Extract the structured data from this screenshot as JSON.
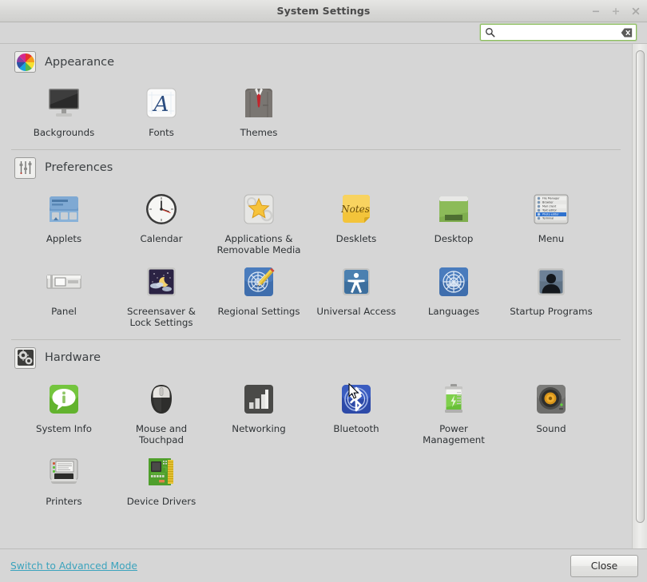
{
  "window": {
    "title": "System Settings",
    "controls": [
      {
        "name": "minimize",
        "glyph": "–"
      },
      {
        "name": "maximize",
        "glyph": "+"
      },
      {
        "name": "close",
        "glyph": "✕"
      }
    ]
  },
  "search": {
    "value": "",
    "placeholder": "",
    "icon": "search-icon",
    "clear_icon": "clear-icon",
    "border_color": "#8dbf5e"
  },
  "sections": [
    {
      "id": "appearance",
      "title": "Appearance",
      "icon": "color-wheel-icon",
      "items": [
        {
          "label": "Backgrounds",
          "icon": "monitor-icon"
        },
        {
          "label": "Fonts",
          "icon": "letter-a-icon"
        },
        {
          "label": "Themes",
          "icon": "suit-tie-icon"
        }
      ]
    },
    {
      "id": "preferences",
      "title": "Preferences",
      "icon": "sliders-icon",
      "items": [
        {
          "label": "Applets",
          "icon": "applets-panel-icon"
        },
        {
          "label": "Calendar",
          "icon": "clock-icon"
        },
        {
          "label": "Applications & Removable Media",
          "icon": "star-icon"
        },
        {
          "label": "Desklets",
          "icon": "sticky-note-icon"
        },
        {
          "label": "Desktop",
          "icon": "green-window-icon"
        },
        {
          "label": "Menu",
          "icon": "menu-list-icon"
        },
        {
          "label": "Panel",
          "icon": "panel-icon"
        },
        {
          "label": "Screensaver & Lock Settings",
          "icon": "night-moon-icon"
        },
        {
          "label": "Regional Settings",
          "icon": "globe-pencil-icon"
        },
        {
          "label": "Universal Access",
          "icon": "accessibility-icon"
        },
        {
          "label": "Languages",
          "icon": "un-globe-icon"
        },
        {
          "label": "Startup Programs",
          "icon": "person-silhouette-icon"
        }
      ]
    },
    {
      "id": "hardware",
      "title": "Hardware",
      "icon": "gears-icon",
      "items": [
        {
          "label": "System Info",
          "icon": "info-bubble-icon"
        },
        {
          "label": "Mouse and Touchpad",
          "icon": "mouse-icon"
        },
        {
          "label": "Networking",
          "icon": "signal-bars-icon"
        },
        {
          "label": "Bluetooth",
          "icon": "bluetooth-icon"
        },
        {
          "label": "Power Management",
          "icon": "battery-icon"
        },
        {
          "label": "Sound",
          "icon": "speaker-icon"
        },
        {
          "label": "Printers",
          "icon": "printer-icon"
        },
        {
          "label": "Device Drivers",
          "icon": "circuit-board-icon"
        }
      ]
    }
  ],
  "menu_icon_entries": [
    "File Manager",
    "Browser",
    "Mail client",
    "Text editor",
    "Photo editor",
    "Terminal"
  ],
  "footer": {
    "advanced_link": "Switch to Advanced Mode",
    "close_label": "Close",
    "link_color": "#3ba3bd"
  },
  "scrollbar": {
    "orientation": "vertical",
    "thumb_position": "top"
  }
}
